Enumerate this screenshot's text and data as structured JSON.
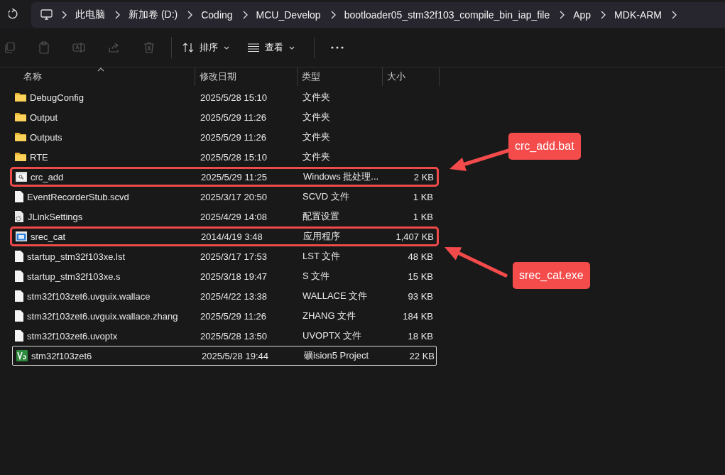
{
  "address_bar": {
    "crumbs": [
      "此电脑",
      "新加卷 (D:)",
      "Coding",
      "MCU_Develop",
      "bootloader05_stm32f103_compile_bin_iap_file",
      "App",
      "MDK-ARM"
    ]
  },
  "toolbar": {
    "sort": "排序",
    "view": "查看"
  },
  "columns": [
    {
      "label": "名称",
      "sorted": true
    },
    {
      "label": "修改日期",
      "sorted": false
    },
    {
      "label": "类型",
      "sorted": false
    },
    {
      "label": "大小",
      "sorted": false
    }
  ],
  "files": [
    {
      "name": "DebugConfig",
      "date": "2025/5/28 15:10",
      "type": "文件夹",
      "kind": "folder",
      "highlighted": false,
      "focused": false
    },
    {
      "name": "Output",
      "date": "2025/5/29 11:26",
      "type": "文件夹",
      "kind": "folder",
      "highlighted": false,
      "focused": false
    },
    {
      "name": "Outputs",
      "date": "2025/5/29 11:26",
      "type": "文件夹",
      "kind": "folder",
      "highlighted": false,
      "focused": false
    },
    {
      "name": "RTE",
      "date": "2025/5/28 15:10",
      "type": "文件夹",
      "kind": "folder",
      "highlighted": false,
      "focused": false
    },
    {
      "name": "crc_add",
      "date": "2025/5/29 11:25",
      "type": "Windows 批处理...",
      "size": "2 KB",
      "kind": "batch",
      "highlighted": true,
      "focused": false
    },
    {
      "name": "EventRecorderStub.scvd",
      "date": "2025/3/17 20:50",
      "type": "SCVD 文件",
      "size": "1 KB",
      "kind": "file",
      "highlighted": false,
      "focused": false
    },
    {
      "name": "JLinkSettings",
      "date": "2025/4/29 14:08",
      "type": "配置设置",
      "size": "1 KB",
      "kind": "config",
      "highlighted": false,
      "focused": false
    },
    {
      "name": "srec_cat",
      "date": "2014/4/19 3:48",
      "type": "应用程序",
      "size": "1,407 KB",
      "kind": "exe",
      "highlighted": true,
      "focused": false
    },
    {
      "name": "startup_stm32f103xe.lst",
      "date": "2025/3/17 17:53",
      "type": "LST 文件",
      "size": "48 KB",
      "kind": "file",
      "highlighted": false,
      "focused": false
    },
    {
      "name": "startup_stm32f103xe.s",
      "date": "2025/3/18 19:47",
      "type": "S 文件",
      "size": "15 KB",
      "kind": "file",
      "highlighted": false,
      "focused": false
    },
    {
      "name": "stm32f103zet6.uvguix.wallace",
      "date": "2025/4/22 13:38",
      "type": "WALLACE 文件",
      "size": "93 KB",
      "kind": "file",
      "highlighted": false,
      "focused": false
    },
    {
      "name": "stm32f103zet6.uvguix.wallace.zhang",
      "date": "2025/5/29 11:26",
      "type": "ZHANG 文件",
      "size": "184 KB",
      "kind": "file",
      "highlighted": false,
      "focused": false
    },
    {
      "name": "stm32f103zet6.uvoptx",
      "date": "2025/5/28 13:50",
      "type": "UVOPTX 文件",
      "size": "18 KB",
      "kind": "file",
      "highlighted": false,
      "focused": false
    },
    {
      "name": "stm32f103zet6",
      "date": "2025/5/28 19:44",
      "type": "礦ision5 Project",
      "size": "22 KB",
      "kind": "project",
      "highlighted": false,
      "focused": true
    }
  ],
  "callouts": [
    {
      "text": "crc_add.bat"
    },
    {
      "text": "srec_cat.exe"
    }
  ]
}
